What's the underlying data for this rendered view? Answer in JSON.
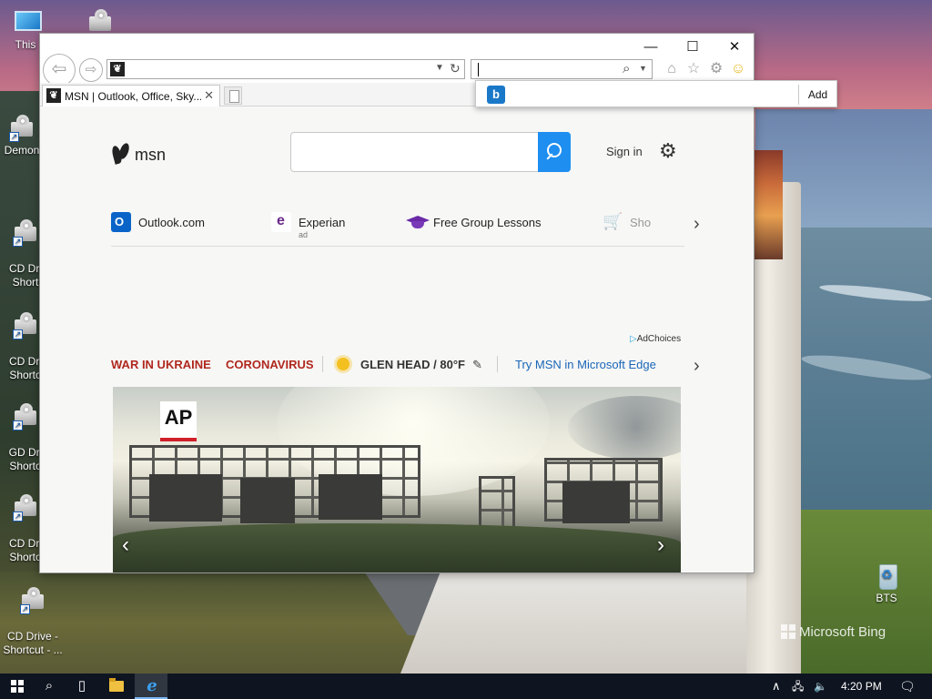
{
  "desktop": {
    "icons": [
      {
        "label": "This",
        "kind": "pc"
      },
      {
        "label": "Demon",
        "kind": "cd"
      },
      {
        "label": "CD Dri\nShort",
        "kind": "cd"
      },
      {
        "label": "CD Dri\nShorto",
        "kind": "cd"
      },
      {
        "label": "GD Dri\nShorto",
        "kind": "cd"
      },
      {
        "label": "CD Dri\nShorto",
        "kind": "cd"
      },
      {
        "label": "CD Drive -\nShortcut - ...",
        "kind": "cd"
      }
    ],
    "recycle_bin_label": "BTS",
    "watermark": "Microsoft Bing"
  },
  "browser": {
    "window_controls": {
      "minimize": "—",
      "maximize": "☐",
      "close": "✕"
    },
    "address_value": "",
    "search_value": "",
    "tab": {
      "title": "MSN | Outlook, Office, Sky..."
    },
    "favicon_glyph": "❦",
    "search_provider_popup": {
      "icon": "b",
      "input_value": "",
      "add_label": "Add"
    }
  },
  "msn": {
    "logo_text": "msn",
    "search_value": "",
    "sign_in": "Sign in",
    "quick_links": [
      {
        "label": "Outlook.com",
        "icon": "outlook-icon"
      },
      {
        "label": "Experian",
        "icon": "experian-icon",
        "sub": "ad"
      },
      {
        "label": "Free Group Lessons",
        "icon": "graduation-cap-icon"
      },
      {
        "label": "Sho",
        "icon": "shopping-cart-icon"
      }
    ],
    "adchoices": "AdChoices",
    "news_bar": {
      "items": [
        {
          "label": "WAR IN UKRAINE"
        },
        {
          "label": "CORONAVIRUS"
        }
      ],
      "weather": "GLEN HEAD / 80°F",
      "edge_link": "Try MSN in Microsoft Edge"
    },
    "hero": {
      "source_logo": "AP"
    }
  },
  "taskbar": {
    "clock": "4:20 PM",
    "tray_chevron": "∧"
  }
}
